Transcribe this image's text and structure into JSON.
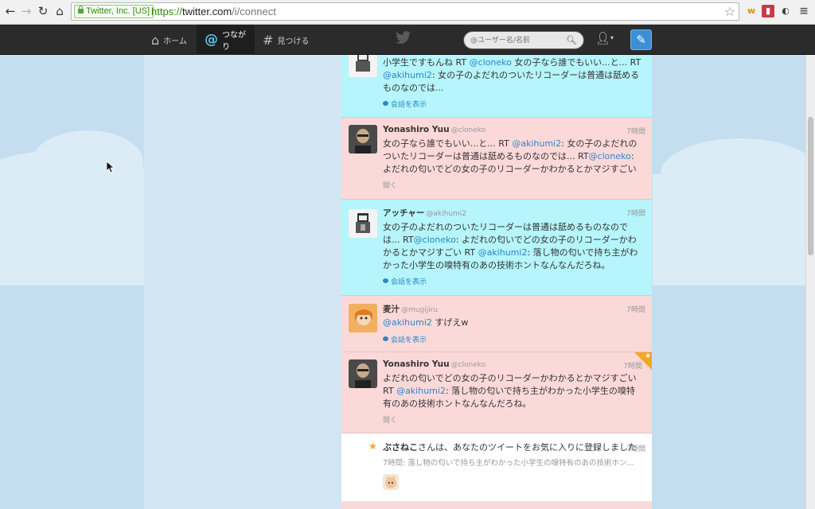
{
  "browser": {
    "site_identity": "Twitter, Inc. [US]",
    "url_scheme": "https://",
    "url_host": "twitter.com",
    "url_path": "/i/connect"
  },
  "topbar": {
    "nav": [
      {
        "label": "ホーム",
        "icon": "home-icon",
        "active": false
      },
      {
        "label": "つながり",
        "icon": "at-icon",
        "active": true
      },
      {
        "label": "見つける",
        "icon": "hash-icon",
        "active": false
      }
    ],
    "search_placeholder": "@ユーザー名/名前"
  },
  "tweets": [
    {
      "style": "cyan",
      "body_parts": [
        {
          "t": "小学生ですもんね RT "
        },
        {
          "t": "@cloneko",
          "m": true
        },
        {
          "t": " 女の子なら誰でもいい...と... RT "
        },
        {
          "t": "@akihumi2",
          "m": true
        },
        {
          "t": ": 女の子のよだれのついたリコーダーは普通は舐めるものなのでは..."
        }
      ],
      "action": "会話を表示",
      "action_kind": "conversation"
    },
    {
      "style": "pink",
      "name": "Yonashiro Yuu",
      "handle": "@cloneko",
      "time": "7時間",
      "body_parts": [
        {
          "t": "女の子なら誰でもいい...と... RT "
        },
        {
          "t": "@akihumi2",
          "m": true
        },
        {
          "t": ": 女の子のよだれのついたリコーダーは普通は舐めるものなのでは... RT"
        },
        {
          "t": "@cloneko",
          "m": true
        },
        {
          "t": ": よだれの匂いでどの女の子のリコーダーかわかるとかマジすごい"
        }
      ],
      "action": "開く",
      "action_kind": "open"
    },
    {
      "style": "cyan",
      "name": "アッチャー",
      "handle": "@akihumi2",
      "time": "7時間",
      "body_parts": [
        {
          "t": "女の子のよだれのついたリコーダーは普通は舐めるものなのでは... RT"
        },
        {
          "t": "@cloneko",
          "m": true
        },
        {
          "t": ": よだれの匂いでどの女の子のリコーダーかわかるとかマジすごい RT "
        },
        {
          "t": "@akihumi2",
          "m": true
        },
        {
          "t": ": 落し物の匂いで持ち主がわかった小学生の嗅特有のあの技術ホントなんなんだろね。"
        }
      ],
      "action": "会話を表示",
      "action_kind": "conversation"
    },
    {
      "style": "pink",
      "name": "麦汁",
      "handle": "@mugijiru",
      "time": "7時間",
      "body_parts": [
        {
          "t": "@akihumi2",
          "m": true
        },
        {
          "t": " すげえw"
        }
      ],
      "action": "会話を表示",
      "action_kind": "conversation"
    },
    {
      "style": "pink",
      "name": "Yonashiro Yuu",
      "handle": "@cloneko",
      "time": "7時間",
      "favorited": true,
      "body_parts": [
        {
          "t": "よだれの匂いでどの女の子のリコーダーかわかるとかマジすごい RT "
        },
        {
          "t": "@akihumi2",
          "m": true
        },
        {
          "t": ": 落し物の匂いで持ち主がわかった小学生の嗅特有のあの技術ホントなんなんだろね。"
        }
      ],
      "action": "開く",
      "action_kind": "open"
    }
  ],
  "notification": {
    "actor": "ぶさねこ",
    "text": "さんは、あなたのツイートをお気に入りに登録しました",
    "time": "7時間",
    "preview": "7時間: 落し物の匂いで持ち主がわかった小学生の嗅特有のあの技術ホン..."
  },
  "colors": {
    "accent": "#2a87c8",
    "cyan_row": "#b5f5fb",
    "pink_row": "#fcd9d9",
    "topbar": "#2b2b2b"
  }
}
